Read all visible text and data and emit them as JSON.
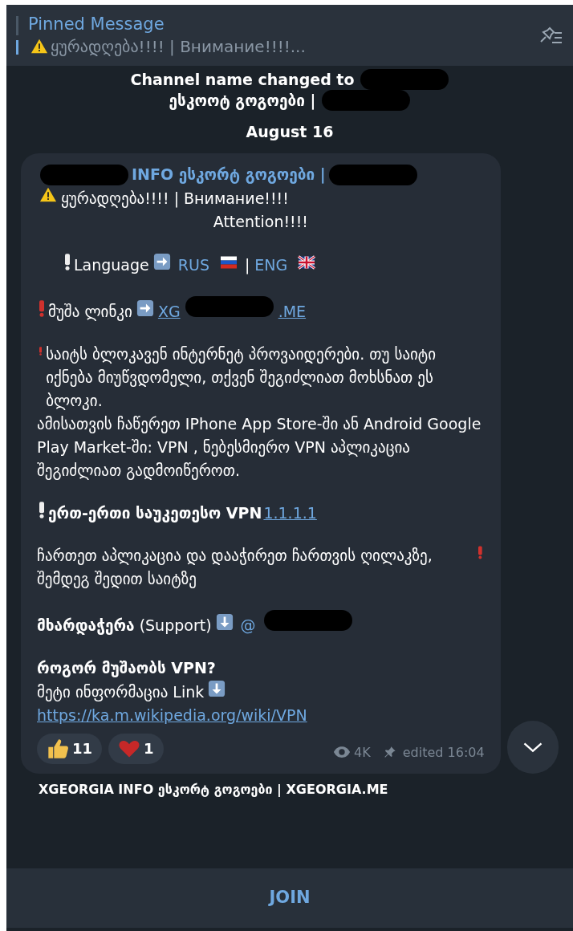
{
  "pinned": {
    "title": "Pinned Message",
    "preview": "ყურადღება!!!! | Внимание!!!!..."
  },
  "service_message": {
    "segments": [
      {
        "kind": "text",
        "text": "Channel name changed to"
      },
      {
        "kind": "redacted"
      },
      {
        "kind": "text",
        "text": "ესკოოტ გოგოები |"
      },
      {
        "kind": "redacted"
      }
    ]
  },
  "date": "August 16",
  "message": {
    "header": [
      {
        "kind": "redacted"
      },
      {
        "kind": "sender",
        "text": "INFO ესკორტ გოგოები |"
      },
      {
        "kind": "redacted"
      }
    ],
    "paragraphs": [
      {
        "spaced": false,
        "kind": "plain",
        "segments": [
          {
            "kind": "warning"
          },
          {
            "kind": "text",
            "text": "ყურადღება!!!! | Внимание!!!!"
          }
        ]
      },
      {
        "spaced": false,
        "kind": "centered",
        "segments": [
          {
            "kind": "text",
            "text": "Attention!!!!"
          }
        ]
      },
      {
        "spaced": true,
        "kind": "indented",
        "segments": [
          {
            "kind": "exclaim_white"
          },
          {
            "kind": "text",
            "text": "Language"
          },
          {
            "kind": "arrow"
          },
          {
            "kind": "link",
            "text": "RUS"
          },
          {
            "kind": "flag_ru"
          },
          {
            "kind": "text",
            "text": "|"
          },
          {
            "kind": "link",
            "text": "ENG"
          },
          {
            "kind": "flag_gb"
          }
        ]
      },
      {
        "spaced": true,
        "kind": "plain",
        "segments": [
          {
            "kind": "exclaim_red"
          },
          {
            "kind": "text",
            "text": "მუშა ლინკი"
          },
          {
            "kind": "arrow"
          },
          {
            "kind": "underlined_link",
            "text": "XG"
          },
          {
            "kind": "redacted"
          },
          {
            "kind": "underlined_link",
            "text": ".ME"
          }
        ]
      },
      {
        "spaced": true,
        "kind": "plain",
        "segments": [
          {
            "kind": "exclaim_red"
          },
          {
            "kind": "text",
            "text": "საიტს ბლოკავენ ინტერნეტ პროვაიდერები. თუ საიტი იქნება მიუწვდომელი, თქვენ შეგიძლიათ მოხსნათ ეს ბლოკი."
          }
        ]
      },
      {
        "spaced": false,
        "kind": "plain",
        "segments": [
          {
            "kind": "text",
            "text": " ამისათვის ჩაწერეთ IPhone App Store-ში ან Android Google Play Market-ში: VPN , ნებესმიერო VPN აპლიკაცია შეგიძლიათ გადმოიწეროთ."
          }
        ]
      },
      {
        "spaced": true,
        "kind": "plain",
        "segments": [
          {
            "kind": "exclaim_white"
          },
          {
            "kind": "bold",
            "text": "ერთ-ერთი საუკეთესო VPN"
          },
          {
            "kind": "underlined_link",
            "text": "1.1.1.1"
          }
        ]
      },
      {
        "spaced": true,
        "kind": "plain",
        "segments": [
          {
            "kind": "text",
            "text": " ჩართეთ აპლიკაცია და დააჭირეთ ჩართვის ღილაკზე, შემდეგ შედით საიტზე"
          },
          {
            "kind": "exclaim_red"
          }
        ]
      },
      {
        "spaced": true,
        "kind": "plain",
        "segments": [
          {
            "kind": "text",
            "text": "**მხარდაჭერა** (Support)"
          },
          {
            "kind": "down_arrow"
          },
          {
            "kind": "link",
            "text": "@"
          },
          {
            "kind": "redacted"
          }
        ]
      },
      {
        "spaced": true,
        "kind": "plain",
        "segments": [
          {
            "kind": "bold",
            "text": " როგორ მუშაობს VPN?"
          }
        ]
      },
      {
        "spaced": false,
        "kind": "plain",
        "segments": [
          {
            "kind": "text",
            "text": "მეტი ინფორმაცია Link"
          },
          {
            "kind": "down_arrow"
          }
        ]
      },
      {
        "spaced": false,
        "kind": "plain",
        "segments": [
          {
            "kind": "underlined_link",
            "text": "https://ka.m.wikipedia.org/wiki/VPN"
          }
        ]
      }
    ],
    "reactions": [
      {
        "kind": "thumbs_up",
        "count": "11"
      },
      {
        "kind": "heart",
        "count": "1"
      }
    ],
    "views": "4K",
    "edited": "edited 16:04"
  },
  "next_message": "XGEORGIA INFO ესკორტ გოგოები | XGEORGIA.ME",
  "join_button": "JOIN"
}
